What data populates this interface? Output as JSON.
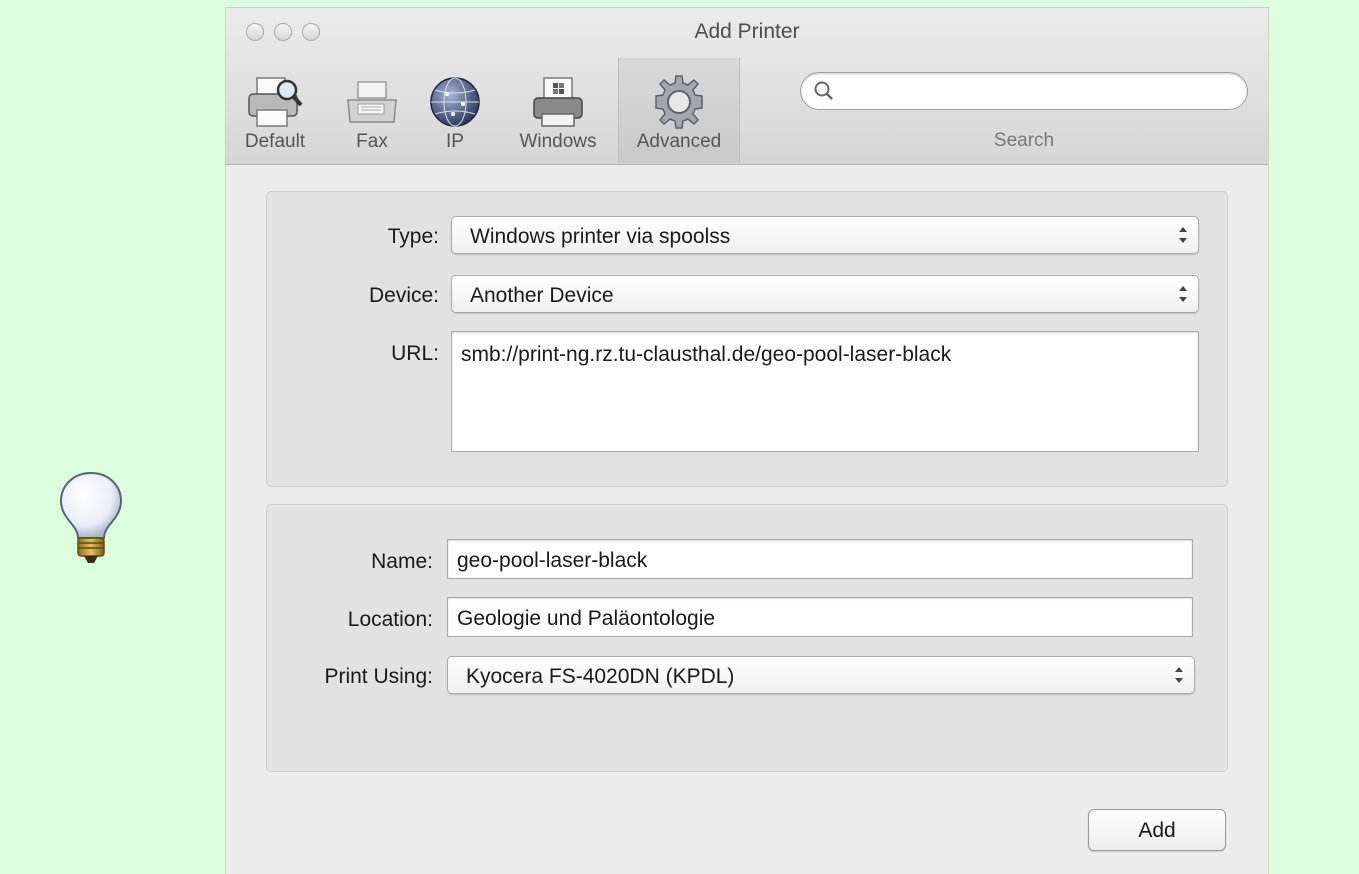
{
  "window": {
    "title": "Add Printer"
  },
  "toolbar": {
    "buttons": [
      {
        "label": "Default",
        "icon": "printer-magnifier-icon"
      },
      {
        "label": "Fax",
        "icon": "fax-icon"
      },
      {
        "label": "IP",
        "icon": "globe-icon"
      },
      {
        "label": "Windows",
        "icon": "windows-printer-icon"
      },
      {
        "label": "Advanced",
        "icon": "gear-icon",
        "active": true
      }
    ],
    "search": {
      "label": "Search",
      "value": ""
    }
  },
  "connection": {
    "type_label": "Type:",
    "type_value": "Windows printer via spoolss",
    "device_label": "Device:",
    "device_value": "Another Device",
    "url_label": "URL:",
    "url_value": "smb://print-ng.rz.tu-clausthal.de/geo-pool-laser-black"
  },
  "details": {
    "name_label": "Name:",
    "name_value": "geo-pool-laser-black",
    "location_label": "Location:",
    "location_value": "Geologie und Paläontologie",
    "print_using_label": "Print Using:",
    "print_using_value": "Kyocera FS-4020DN (KPDL)"
  },
  "actions": {
    "add_label": "Add"
  },
  "colors": {
    "page_background": "#dcfedc",
    "window_background": "#ececec"
  }
}
